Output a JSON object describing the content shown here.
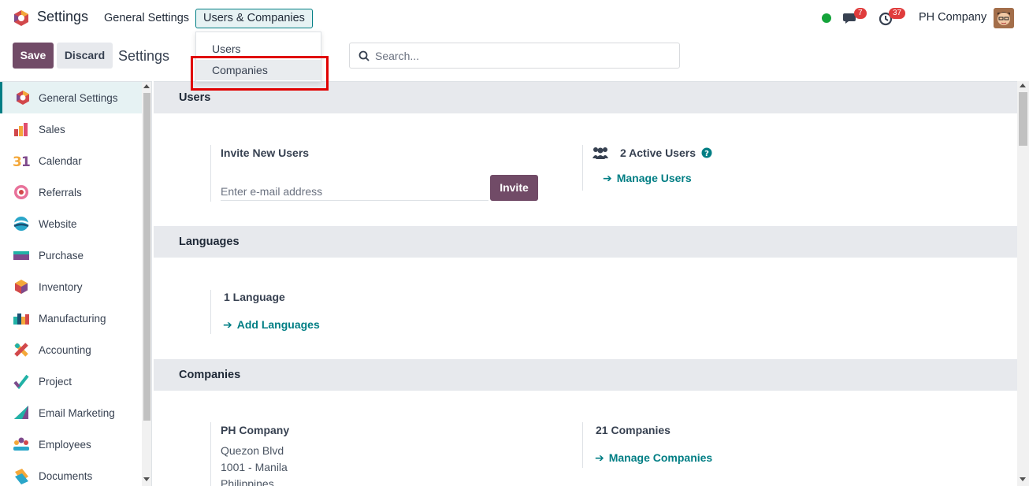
{
  "navbar": {
    "app_name": "Settings",
    "menu_general": "General Settings",
    "menu_users_companies": "Users & Companies",
    "chat_badge": "7",
    "activity_badge": "37",
    "company": "PH Company"
  },
  "dropdown": {
    "items": [
      "Users",
      "Companies"
    ],
    "highlighted": "Companies"
  },
  "control_panel": {
    "save_label": "Save",
    "discard_label": "Discard",
    "title": "Settings",
    "search_placeholder": "Search..."
  },
  "sidebar": {
    "items": [
      {
        "label": "General Settings",
        "icon": "settings-hex-icon",
        "active": true
      },
      {
        "label": "Sales",
        "icon": "sales-chart-icon"
      },
      {
        "label": "Calendar",
        "icon": "calendar-31-icon"
      },
      {
        "label": "Referrals",
        "icon": "referrals-icon"
      },
      {
        "label": "Website",
        "icon": "website-icon"
      },
      {
        "label": "Purchase",
        "icon": "purchase-icon"
      },
      {
        "label": "Inventory",
        "icon": "inventory-box-icon"
      },
      {
        "label": "Manufacturing",
        "icon": "manufacturing-icon"
      },
      {
        "label": "Accounting",
        "icon": "accounting-icon"
      },
      {
        "label": "Project",
        "icon": "project-check-icon"
      },
      {
        "label": "Email Marketing",
        "icon": "email-marketing-icon"
      },
      {
        "label": "Employees",
        "icon": "employees-icon"
      },
      {
        "label": "Documents",
        "icon": "documents-icon"
      }
    ]
  },
  "sections": {
    "users": {
      "heading": "Users",
      "invite_title": "Invite New Users",
      "email_placeholder": "Enter e-mail address",
      "invite_button": "Invite",
      "active_users": "2 Active Users",
      "manage_users": "Manage Users"
    },
    "languages": {
      "heading": "Languages",
      "count": "1 Language",
      "add_languages": "Add Languages"
    },
    "companies": {
      "heading": "Companies",
      "company_name": "PH Company",
      "address": [
        "Quezon Blvd",
        "1001 - Manila",
        "Philippines"
      ],
      "count": "21 Companies",
      "manage_companies": "Manage Companies"
    }
  },
  "colors": {
    "brand": "#714b67",
    "accent": "#017e84",
    "highlight": "#e00000"
  }
}
